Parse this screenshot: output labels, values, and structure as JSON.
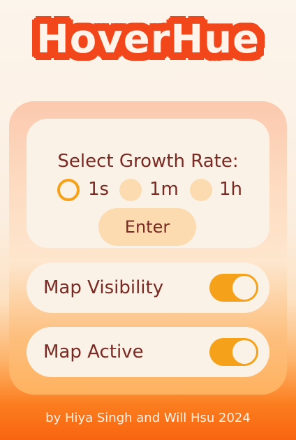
{
  "app": {
    "title": "HoverHue"
  },
  "growth_rate": {
    "title": "Select Growth Rate:",
    "options": [
      {
        "label": "1s",
        "selected": true
      },
      {
        "label": "1m",
        "selected": false
      },
      {
        "label": "1h",
        "selected": false
      }
    ],
    "enter_label": "Enter"
  },
  "toggles": {
    "map_visibility": {
      "label": "Map Visibility",
      "on": true
    },
    "map_active": {
      "label": "Map Active",
      "on": true
    }
  },
  "footer": {
    "text": "by Hiya Singh and Will Hsu 2024"
  },
  "colors": {
    "brand": "#f2461b",
    "accent": "#f6a11a",
    "text": "#7a2a22",
    "card": "#fbf2e7"
  }
}
